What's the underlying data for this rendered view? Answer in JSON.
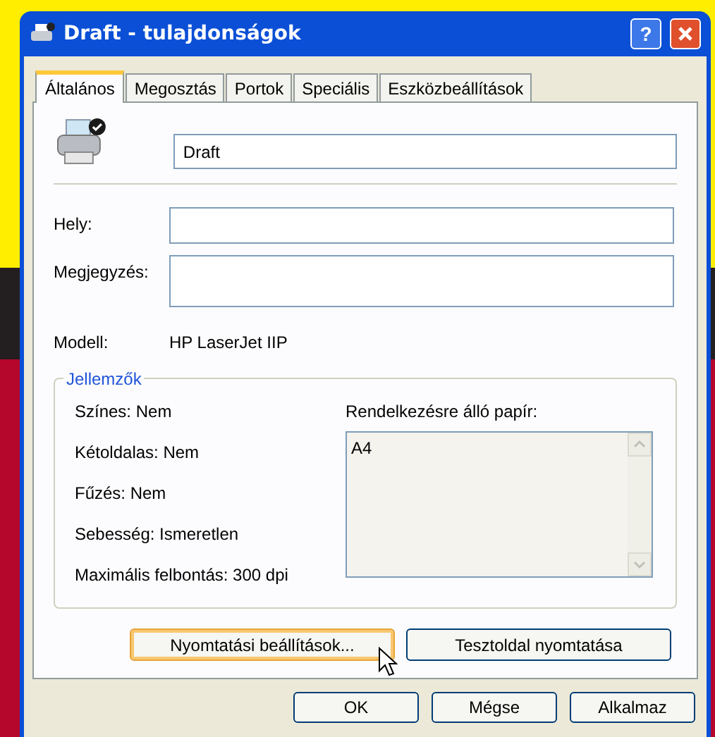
{
  "window": {
    "title": "Draft - tulajdonságok",
    "help_button": "?"
  },
  "tabs": [
    {
      "label": "Általános",
      "selected": true
    },
    {
      "label": "Megosztás",
      "selected": false
    },
    {
      "label": "Portok",
      "selected": false
    },
    {
      "label": "Speciális",
      "selected": false
    },
    {
      "label": "Eszközbeállítások",
      "selected": false
    }
  ],
  "printer_name": {
    "value": "Draft"
  },
  "fields": [
    {
      "label": "Hely:",
      "kind": "single"
    },
    {
      "label": "Megjegyzés:",
      "kind": "multi"
    }
  ],
  "model": {
    "label": "Modell:",
    "value": "HP LaserJet IIP"
  },
  "features": {
    "title": "Jellemzők",
    "items": [
      "Színes: Nem",
      "Kétoldalas: Nem",
      "Fűzés: Nem",
      "Sebesség: Ismeretlen",
      "Maximális felbontás: 300 dpi"
    ],
    "paper": {
      "label": "Rendelkezésre álló papír:",
      "items": [
        "A4"
      ]
    }
  },
  "action_buttons": [
    {
      "label": "Nyomtatási beállítások...",
      "hovered": true
    },
    {
      "label": "Tesztoldal nyomtatása",
      "hovered": false
    }
  ],
  "dialog_buttons": [
    "OK",
    "Mégse",
    "Alkalmaz"
  ]
}
